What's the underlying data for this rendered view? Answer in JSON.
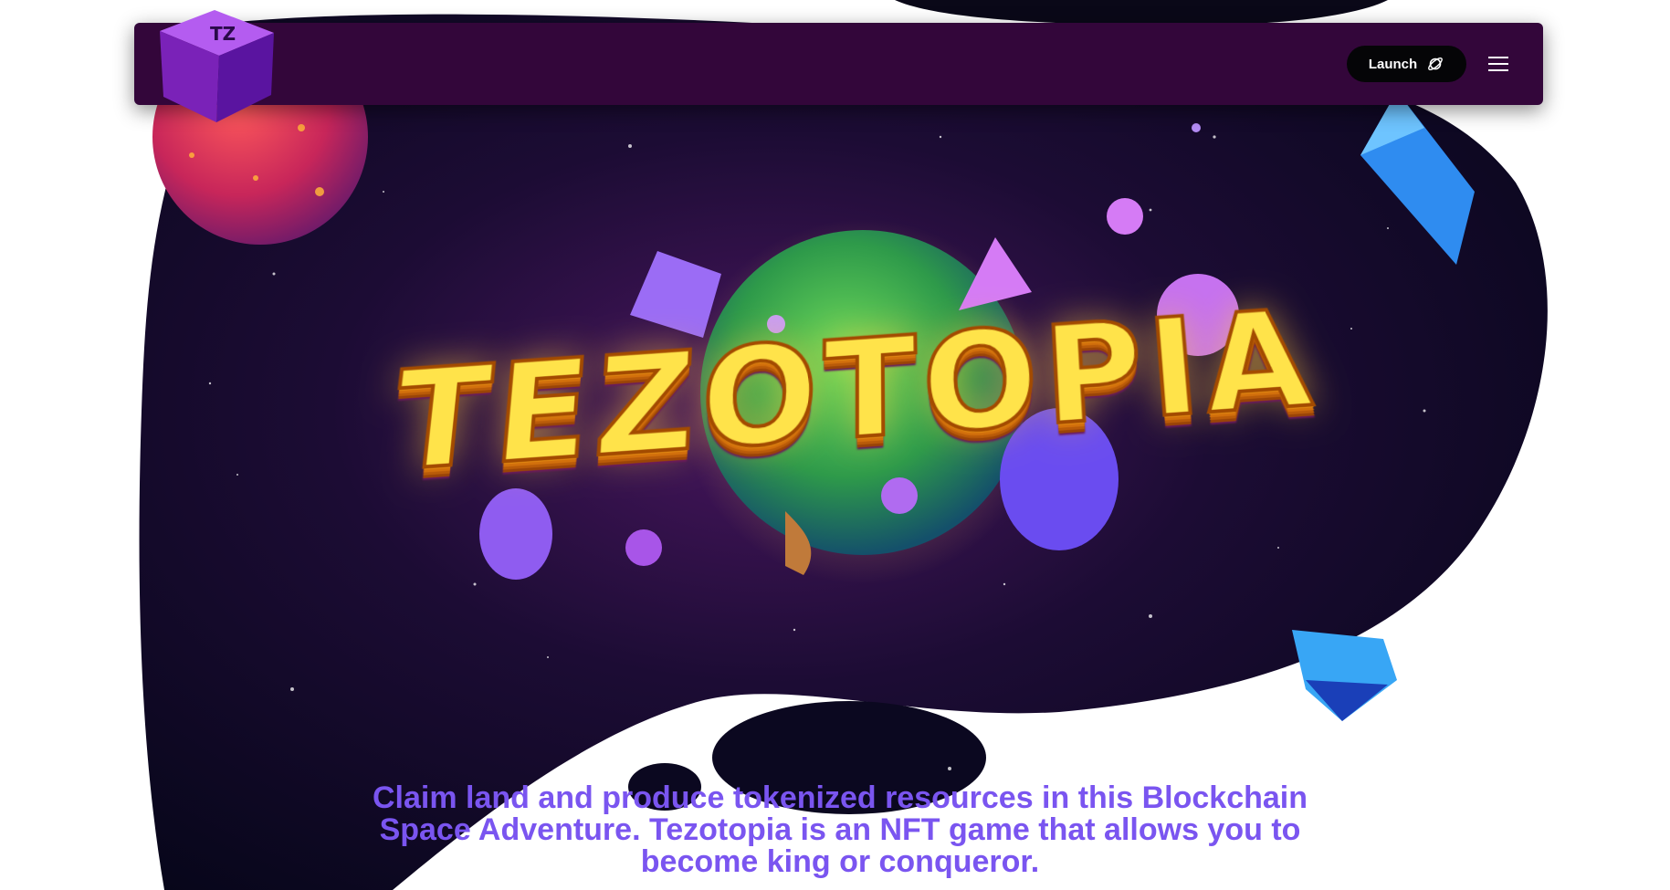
{
  "brand": {
    "logo_icon": "tz-cube-logo-icon",
    "primary_color": "#33063a",
    "accent_color": "#7a55f0"
  },
  "nav": {
    "launch_label": "Launch",
    "launch_icon": "planet-icon",
    "menu_icon": "hamburger-menu-icon"
  },
  "hero": {
    "title": "TEZOTOPIA",
    "tagline": "Claim land and produce tokenized resources in this Blockchain Space Adventure. Tezotopia is an NFT game that allows you to become king or conqueror."
  }
}
